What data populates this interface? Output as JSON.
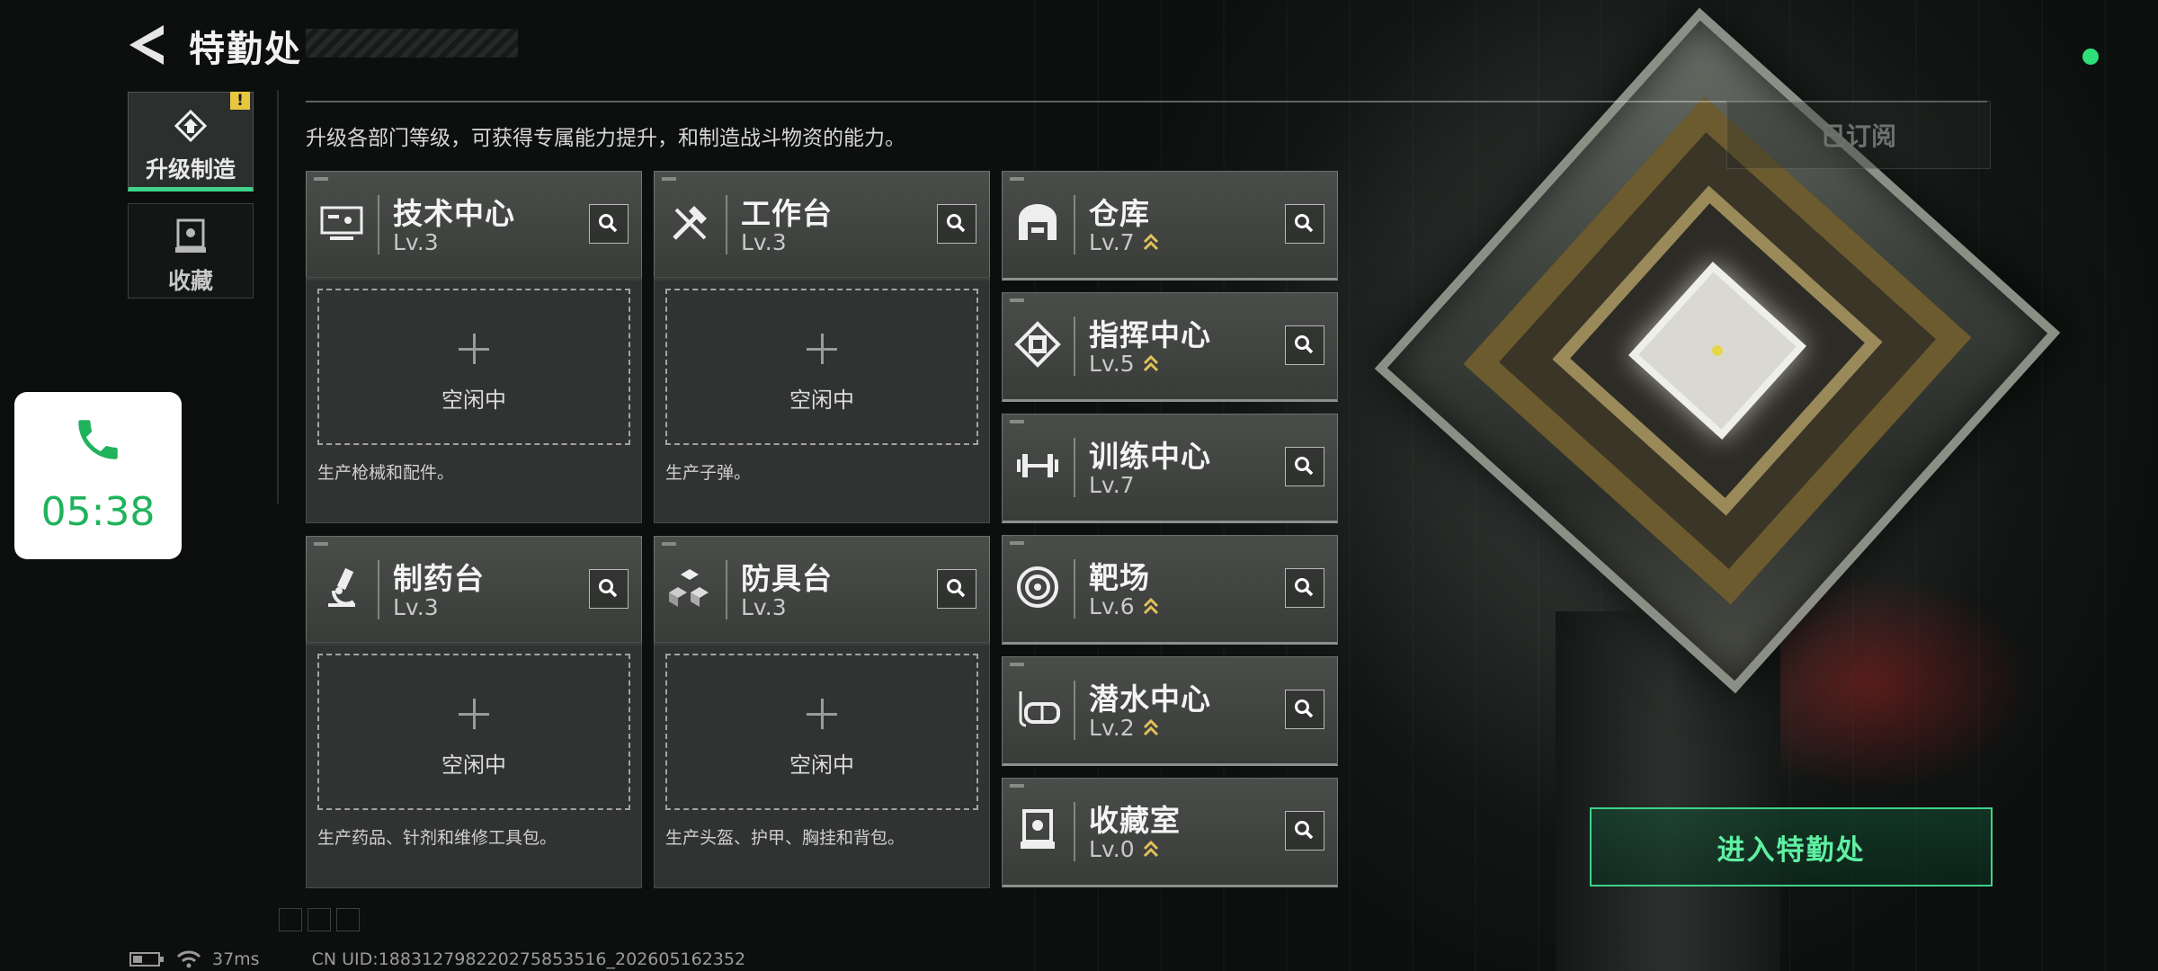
{
  "header": {
    "title": "特勤处",
    "subtitle": "升级各部门等级，可获得专属能力提升，和制造战斗物资的能力。",
    "subscribed_label": "已订阅"
  },
  "nav": {
    "items": [
      {
        "label": "升级制造",
        "active": true,
        "alert_badge": "!"
      },
      {
        "label": "收藏",
        "active": false
      }
    ]
  },
  "call_widget": {
    "time": "05:38"
  },
  "production": [
    {
      "name": "技术中心",
      "level": "Lv.3",
      "icon": "monitor-icon",
      "slot": "空闲中",
      "desc": "生产枪械和配件。"
    },
    {
      "name": "工作台",
      "level": "Lv.3",
      "icon": "tools-icon",
      "slot": "空闲中",
      "desc": "生产子弹。"
    },
    {
      "name": "制药台",
      "level": "Lv.3",
      "icon": "microscope-icon",
      "slot": "空闲中",
      "desc": "生产药品、针剂和维修工具包。"
    },
    {
      "name": "防具台",
      "level": "Lv.3",
      "icon": "cubes-icon",
      "slot": "空闲中",
      "desc": "生产头盔、护甲、胸挂和背包。"
    }
  ],
  "departments": [
    {
      "name": "仓库",
      "level": "Lv.7",
      "icon": "warehouse-icon",
      "upgradable": true
    },
    {
      "name": "指挥中心",
      "level": "Lv.5",
      "icon": "chip-icon",
      "upgradable": true
    },
    {
      "name": "训练中心",
      "level": "Lv.7",
      "icon": "dumbbell-icon",
      "upgradable": false
    },
    {
      "name": "靶场",
      "level": "Lv.6",
      "icon": "target-icon",
      "upgradable": true
    },
    {
      "name": "潜水中心",
      "level": "Lv.2",
      "icon": "diving-mask-icon",
      "upgradable": true
    },
    {
      "name": "收藏室",
      "level": "Lv.0",
      "icon": "display-case-icon",
      "upgradable": true
    }
  ],
  "enter_button": {
    "label": "进入特勤处"
  },
  "status_bar": {
    "ping": "37ms",
    "uid": "CN UID:1883127982202758535​16_202605162352"
  },
  "colors": {
    "accent_green": "#3fd28a",
    "upgrade_gold": "#e2c15a",
    "call_green": "#1fb35c"
  }
}
